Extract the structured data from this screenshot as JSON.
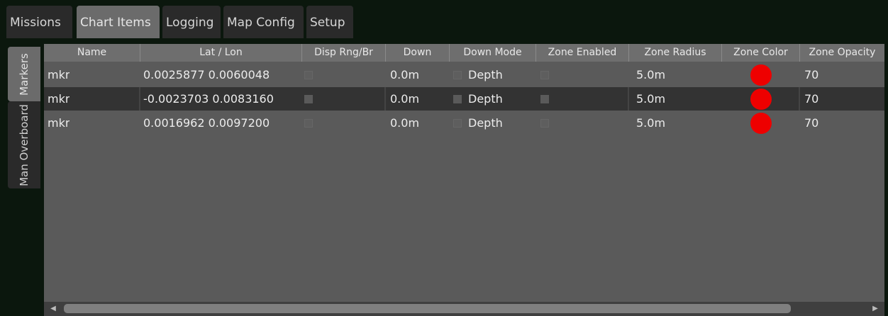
{
  "tabs": [
    {
      "label": "Missions",
      "active": false
    },
    {
      "label": "Chart Items",
      "active": true
    },
    {
      "label": "Logging",
      "active": false
    },
    {
      "label": "Map Config",
      "active": false
    },
    {
      "label": "Setup",
      "active": false
    }
  ],
  "side_tabs": [
    {
      "label": "Markers",
      "active": true
    },
    {
      "label": "Man Overboard",
      "active": false
    }
  ],
  "table": {
    "columns": [
      "Name",
      "Lat / Lon",
      "Disp Rng/Br",
      "Down",
      "Down Mode",
      "Zone Enabled",
      "Zone Radius",
      "Zone Color",
      "Zone Opacity"
    ],
    "rows": [
      {
        "name": "mkr",
        "latlon": "0.0025877 0.0060048",
        "disp_rng_br": false,
        "down": "0.0m",
        "down_mode_checked": false,
        "down_mode": "Depth",
        "zone_enabled": false,
        "zone_radius": "5.0m",
        "zone_color": "#ee0000",
        "zone_opacity": "70",
        "selected": false
      },
      {
        "name": "mkr",
        "latlon": "-0.0023703 0.0083160",
        "disp_rng_br": false,
        "down": "0.0m",
        "down_mode_checked": false,
        "down_mode": "Depth",
        "zone_enabled": false,
        "zone_radius": "5.0m",
        "zone_color": "#ee0000",
        "zone_opacity": "70",
        "selected": true
      },
      {
        "name": "mkr",
        "latlon": "0.0016962 0.0097200",
        "disp_rng_br": false,
        "down": "0.0m",
        "down_mode_checked": false,
        "down_mode": "Depth",
        "zone_enabled": false,
        "zone_radius": "5.0m",
        "zone_color": "#ee0000",
        "zone_opacity": "70",
        "selected": false
      }
    ]
  },
  "scrollbar": {
    "left_icon": "arrow-left-icon",
    "right_icon": "arrow-right-icon"
  }
}
